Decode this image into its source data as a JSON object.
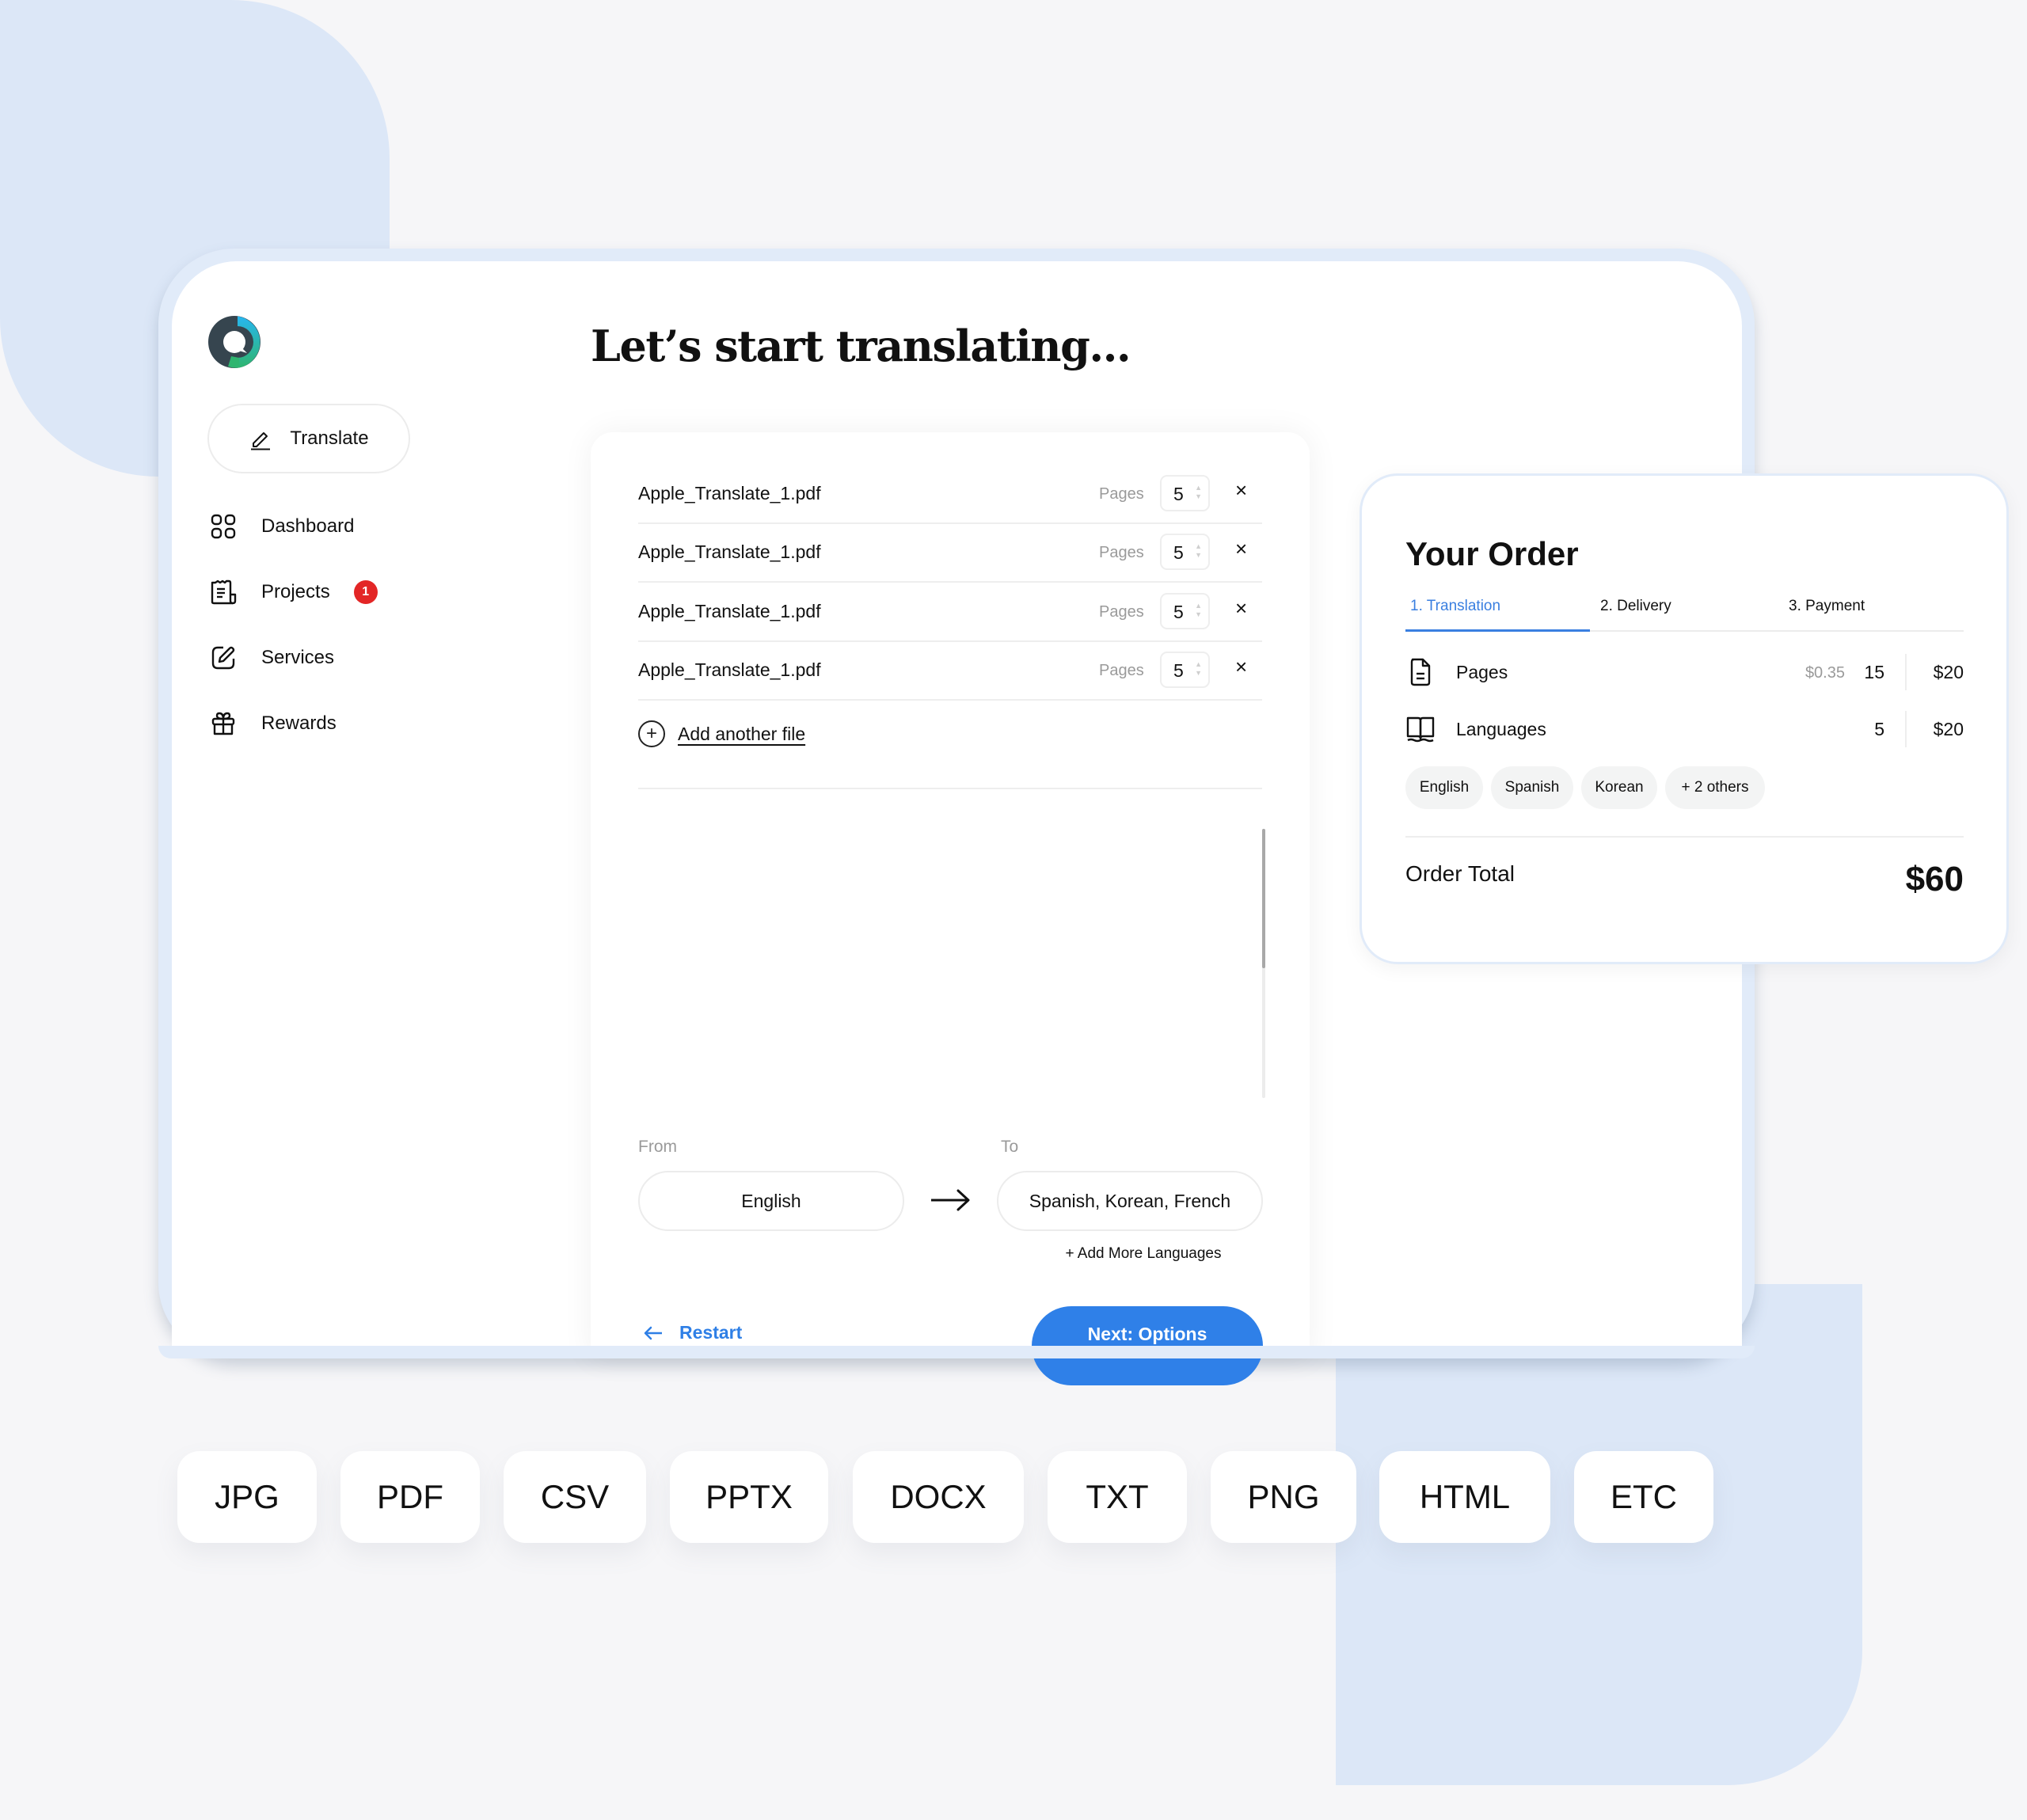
{
  "sidebar": {
    "logo": "app-logo",
    "translate_button": "Translate",
    "items": [
      {
        "label": "Dashboard",
        "icon": "grid-icon"
      },
      {
        "label": "Projects",
        "icon": "receipt-icon",
        "badge": "1"
      },
      {
        "label": "Services",
        "icon": "edit-square-icon"
      },
      {
        "label": "Rewards",
        "icon": "gift-icon"
      }
    ]
  },
  "main": {
    "heading": "Let’s start translating...",
    "files": [
      {
        "name": "Apple_Translate_1.pdf",
        "pages_label": "Pages",
        "pages": "5"
      },
      {
        "name": "Apple_Translate_1.pdf",
        "pages_label": "Pages",
        "pages": "5"
      },
      {
        "name": "Apple_Translate_1.pdf",
        "pages_label": "Pages",
        "pages": "5"
      },
      {
        "name": "Apple_Translate_1.pdf",
        "pages_label": "Pages",
        "pages": "5"
      }
    ],
    "remove_glyph": "×",
    "add_file": "Add another file",
    "from_label": "From",
    "to_label": "To",
    "from_value": "English",
    "to_value": "Spanish, Korean, French",
    "add_languages": "+ Add More Languages",
    "restart": "Restart",
    "next": "Next: Options",
    "scroll_position": 0
  },
  "order": {
    "title": "Your Order",
    "steps": [
      {
        "label": "1. Translation",
        "active": true
      },
      {
        "label": "2. Delivery",
        "active": false
      },
      {
        "label": "3. Payment",
        "active": false
      }
    ],
    "lines": [
      {
        "icon": "document-icon",
        "name": "Pages",
        "unit_price": "$0.35",
        "qty": "15",
        "amount": "$20"
      },
      {
        "icon": "book-icon",
        "name": "Languages",
        "unit_price": "",
        "qty": "5",
        "amount": "$20"
      }
    ],
    "languages": [
      "English",
      "Spanish",
      "Korean",
      "+ 2 others"
    ],
    "total_label": "Order Total",
    "total_value": "$60"
  },
  "formats": [
    "JPG",
    "PDF",
    "CSV",
    "PPTX",
    "DOCX",
    "TXT",
    "PNG",
    "HTML",
    "ETC"
  ],
  "colors": {
    "accent": "#2f80e8",
    "badge": "#e32626",
    "background": "#f6f6f8",
    "decor_blue": "#dce7f7"
  }
}
